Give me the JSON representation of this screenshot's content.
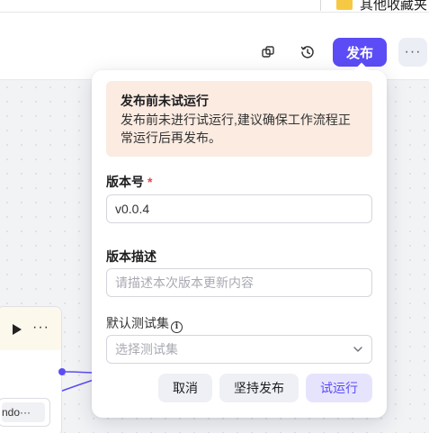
{
  "bookmarks": {
    "folder_label": "其他收藏夹"
  },
  "header": {
    "icons": [
      "copy-window-icon",
      "history-icon"
    ],
    "publish_label": "发布",
    "more_label": "···"
  },
  "canvas": {
    "node": {
      "more_label": "···",
      "chip_text": "ndo···"
    }
  },
  "popover": {
    "warning": {
      "title": "发布前未试运行",
      "text": "发布前未进行试运行,建议确保工作流程正常运行后再发布。"
    },
    "version": {
      "label": "版本号",
      "required_mark": "*",
      "value": "v0.0.4"
    },
    "description": {
      "label": "版本描述",
      "placeholder": "请描述本次版本更新内容"
    },
    "testset": {
      "label": "默认测试集",
      "info_glyph": "i",
      "placeholder": "选择测试集"
    },
    "buttons": {
      "cancel": "取消",
      "force_publish": "坚持发布",
      "trial_run": "试运行"
    }
  },
  "colors": {
    "accent": "#5b4cf5",
    "warning_bg": "#fbebe1",
    "required": "#e5484d"
  }
}
